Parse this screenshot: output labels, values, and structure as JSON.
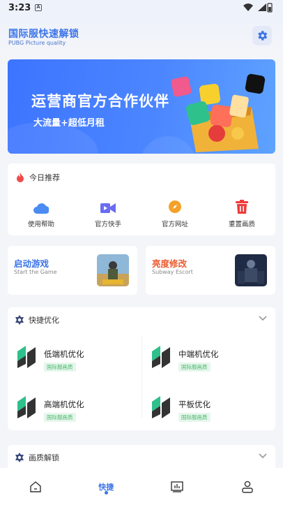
{
  "status_bar": {
    "time": "3:23",
    "notif_glyph": "A"
  },
  "header": {
    "title": "国际服快速解锁",
    "subtitle": "PUBG Picture quality"
  },
  "banner": {
    "headline": "运营商官方合作伙伴",
    "subline": "大流量+超低月租"
  },
  "recommend": {
    "title": "今日推荐",
    "items": [
      {
        "label": "使用帮助",
        "icon": "cloud-icon",
        "color": "#4a8cf2"
      },
      {
        "label": "官方快手",
        "icon": "video-camera-icon",
        "color": "#6a6cf2"
      },
      {
        "label": "官方网址",
        "icon": "compass-icon",
        "color": "#f4a12a"
      },
      {
        "label": "重置画质",
        "icon": "trash-icon",
        "color": "#ef3b3b"
      }
    ]
  },
  "games": [
    {
      "title": "启动游戏",
      "subtitle": "Start the Game",
      "color": "#3d74e8"
    },
    {
      "title": "亮度修改",
      "subtitle": "Subway Escort",
      "color": "#ec5a2e"
    }
  ],
  "quick": {
    "title": "快捷优化",
    "items": [
      {
        "label": "低端机优化",
        "tag": "国际服画质"
      },
      {
        "label": "中端机优化",
        "tag": "国际服画质"
      },
      {
        "label": "高端机优化",
        "tag": "国际服画质"
      },
      {
        "label": "平板优化",
        "tag": "国际服画质"
      }
    ]
  },
  "unlock": {
    "title": "画质解锁"
  },
  "tabbar": {
    "tabs": [
      {
        "icon": "home-icon"
      },
      {
        "label": "快捷",
        "active": true
      },
      {
        "icon": "chart-icon"
      },
      {
        "icon": "profile-icon"
      }
    ]
  },
  "colors": {
    "accent": "#3d74e8",
    "tag_green": "#47b86a",
    "background": "#f3f5f9"
  }
}
